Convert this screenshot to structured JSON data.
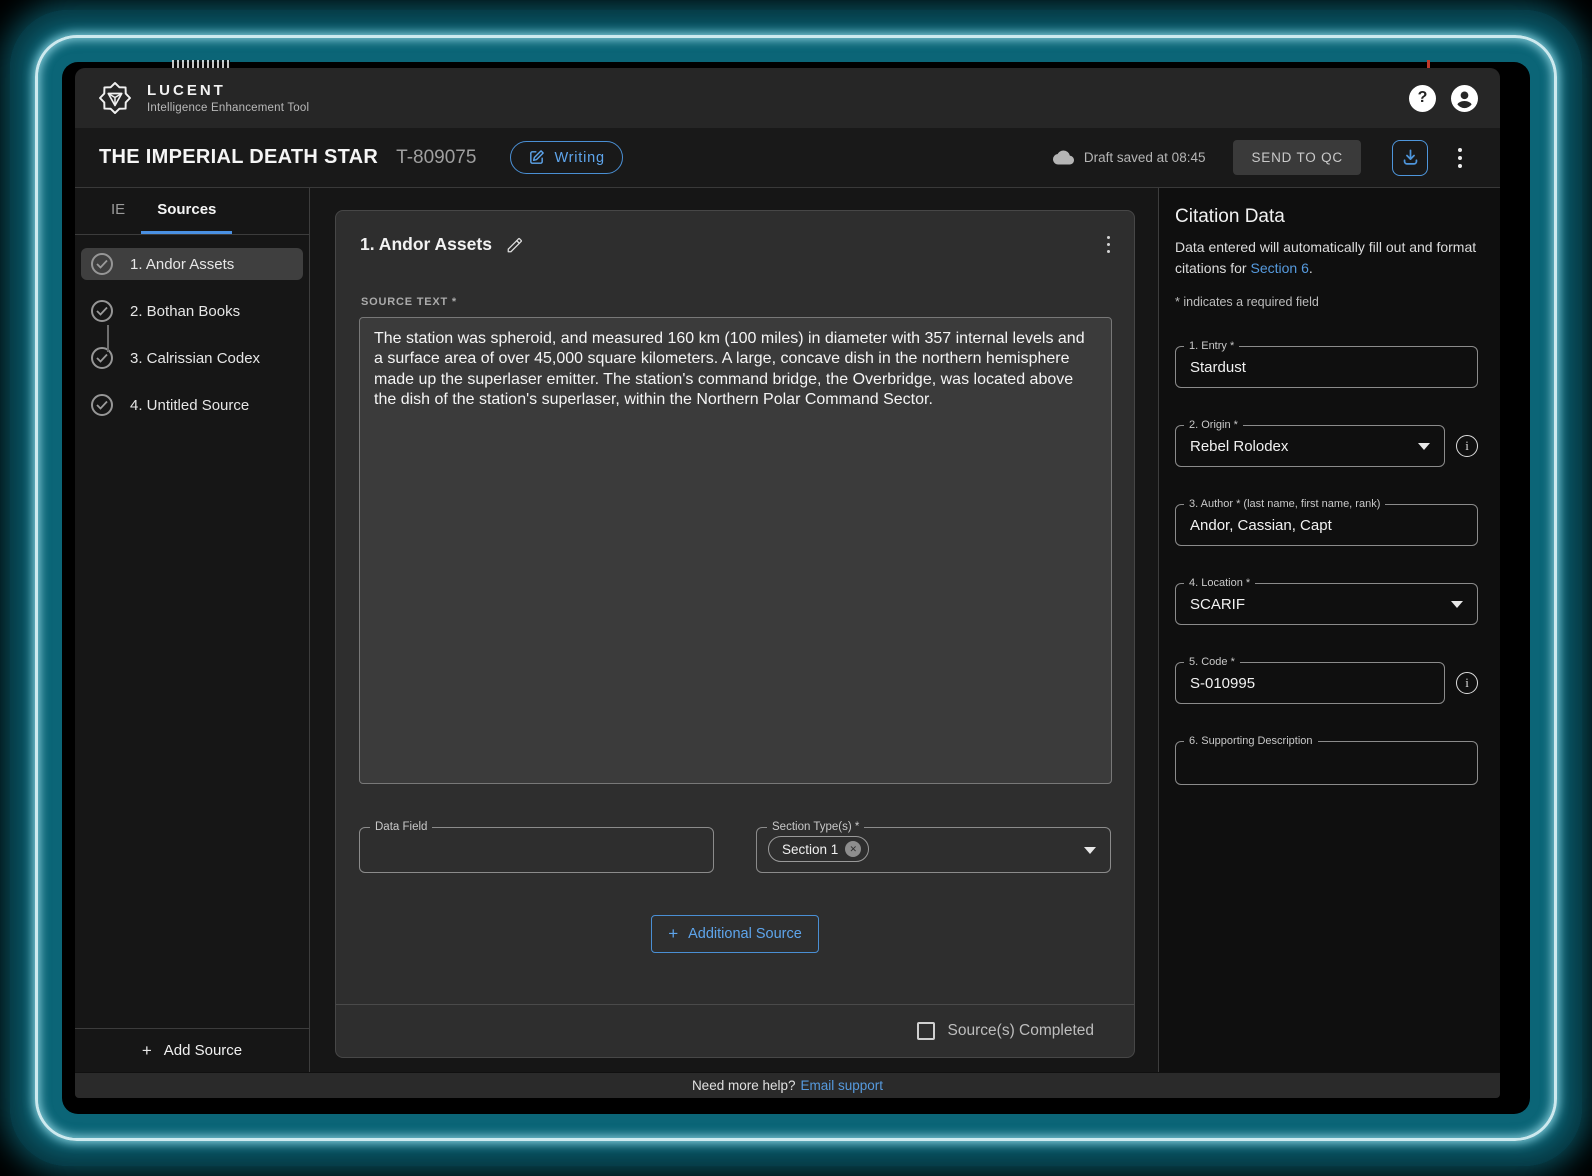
{
  "app_bar": {
    "brand": "LUCENT",
    "subtitle": "Intelligence Enhancement Tool"
  },
  "header": {
    "title": "THE IMPERIAL DEATH STAR",
    "doc_id": "T-809075",
    "mode_button": "Writing",
    "draft_status": "Draft saved at 08:45",
    "send_to_qc": "SEND TO QC"
  },
  "sidebar": {
    "tabs": {
      "ie": "IE",
      "sources": "Sources"
    },
    "items": [
      {
        "label": "1. Andor Assets"
      },
      {
        "label": "2. Bothan Books"
      },
      {
        "label": "3. Calrissian Codex"
      },
      {
        "label": "4. Untitled Source"
      }
    ],
    "add_source": "Add Source"
  },
  "source_editor": {
    "title": "1. Andor Assets",
    "source_text_label": "SOURCE TEXT *",
    "source_text": "The station was spheroid, and measured 160 km (100 miles) in diameter with 357 internal levels and a surface area of over 45,000 square kilometers. A large, concave dish in the northern hemisphere made up the superlaser emitter. The station's command bridge, the Overbridge, was located above the dish of the station's superlaser, within the Northern Polar Command Sector.",
    "data_field_label": "Data Field",
    "section_types_label": "Section Type(s) *",
    "section_chip": "Section 1",
    "additional_source": "Additional Source",
    "completed_label": "Source(s) Completed"
  },
  "citation": {
    "title": "Citation Data",
    "description_prefix": "Data entered will automatically fill out and format citations for ",
    "description_link": "Section 6",
    "description_suffix": ".",
    "required_note": "* indicates a required field",
    "fields": [
      {
        "label": "1. Entry *",
        "value": "Stardust"
      },
      {
        "label": "2. Origin *",
        "value": "Rebel Rolodex"
      },
      {
        "label": "3. Author * (last name, first name, rank)",
        "value": "Andor, Cassian, Capt"
      },
      {
        "label": "4. Location *",
        "value": "SCARIF"
      },
      {
        "label": "5. Code *",
        "value": "S-010995"
      },
      {
        "label": "6. Supporting Description",
        "value": ""
      }
    ]
  },
  "footer": {
    "text": "Need more help?",
    "link": "Email support"
  },
  "icons": {
    "plus": "+",
    "help": "?",
    "info": "i",
    "chip_remove": "✕"
  },
  "colors": {
    "accent_blue": "#5b9fe3",
    "link_blue": "#569ade",
    "frame_teal": "#0b6577",
    "tab_underline": "#4a90e2"
  }
}
